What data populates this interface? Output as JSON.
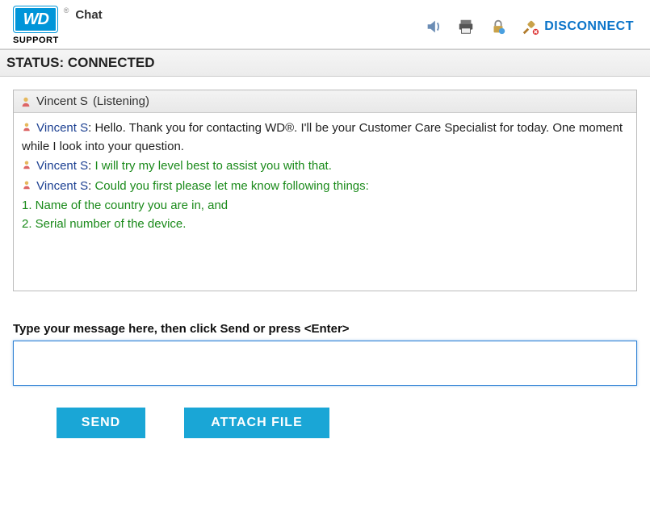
{
  "brand": {
    "logo_text": "WD",
    "support_text": "SUPPORT",
    "chat_label": "Chat"
  },
  "toolbar": {
    "sound_icon": "sound-icon",
    "print_icon": "print-icon",
    "lock_icon": "lock-icon",
    "disconnect_icon": "plug-disconnect-icon",
    "disconnect_label": "DISCONNECT"
  },
  "status": {
    "label": "STATUS:",
    "value": "CONNECTED"
  },
  "chat": {
    "header_name": "Vincent S",
    "header_state": "(Listening)",
    "messages": [
      {
        "name": "Vincent S",
        "color": "black",
        "text": "Hello. Thank you for contacting WD®. I'll be your Customer Care Specialist for today. One moment while I look into your question."
      },
      {
        "name": "Vincent S",
        "color": "green",
        "text": " I will try my level best to assist you with that."
      },
      {
        "name": "Vincent S",
        "color": "green",
        "text": "Could you first please let me know following things:"
      }
    ],
    "list": [
      "1. Name of the country you are in,  and",
      "2. Serial number of the device."
    ]
  },
  "input": {
    "label": "Type your message here, then click Send or press <Enter>",
    "value": ""
  },
  "buttons": {
    "send": "SEND",
    "attach": "ATTACH FILE"
  }
}
